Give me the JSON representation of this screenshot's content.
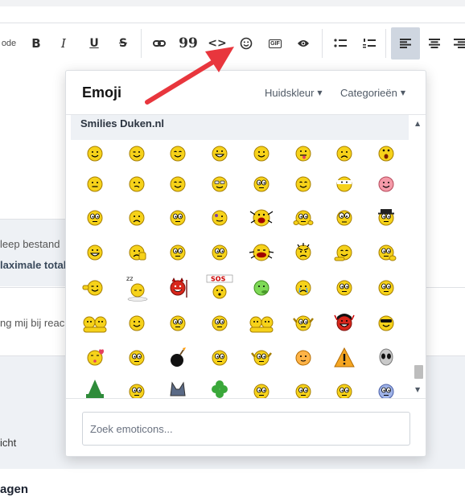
{
  "toolbar": {
    "code_partial": "ode",
    "bold": "B",
    "italic": "I",
    "underline": "U",
    "strike": "S",
    "quote": "99",
    "code": "<>",
    "gif": "GIF"
  },
  "background": {
    "attach_line1": "leep bestand",
    "attach_line2": "laximale total",
    "notify_text": "ng mij bij reac",
    "bericht_text": "icht",
    "vragen_text": "agen"
  },
  "emoji_popup": {
    "title": "Emoji",
    "skin_tone_label": "Huidskleur",
    "categories_label": "Categorieën",
    "category_title": "Smilies Duken.nl",
    "search_placeholder": "Zoek emoticons...",
    "sleep_text": "zz",
    "sos_text": "SOS"
  },
  "colors": {
    "accent_arrow": "#e8363d",
    "smiley_yellow": "#f6d21a",
    "smiley_outline": "#a57d00",
    "toolbar_active_bg": "#cfd6e0"
  },
  "icons": [
    "link-icon",
    "quote-icon",
    "code-icon",
    "smiley-icon",
    "gif-icon",
    "eye-icon",
    "bullet-list-icon",
    "numbered-list-icon",
    "align-left-icon",
    "align-center-icon",
    "align-right-icon"
  ]
}
